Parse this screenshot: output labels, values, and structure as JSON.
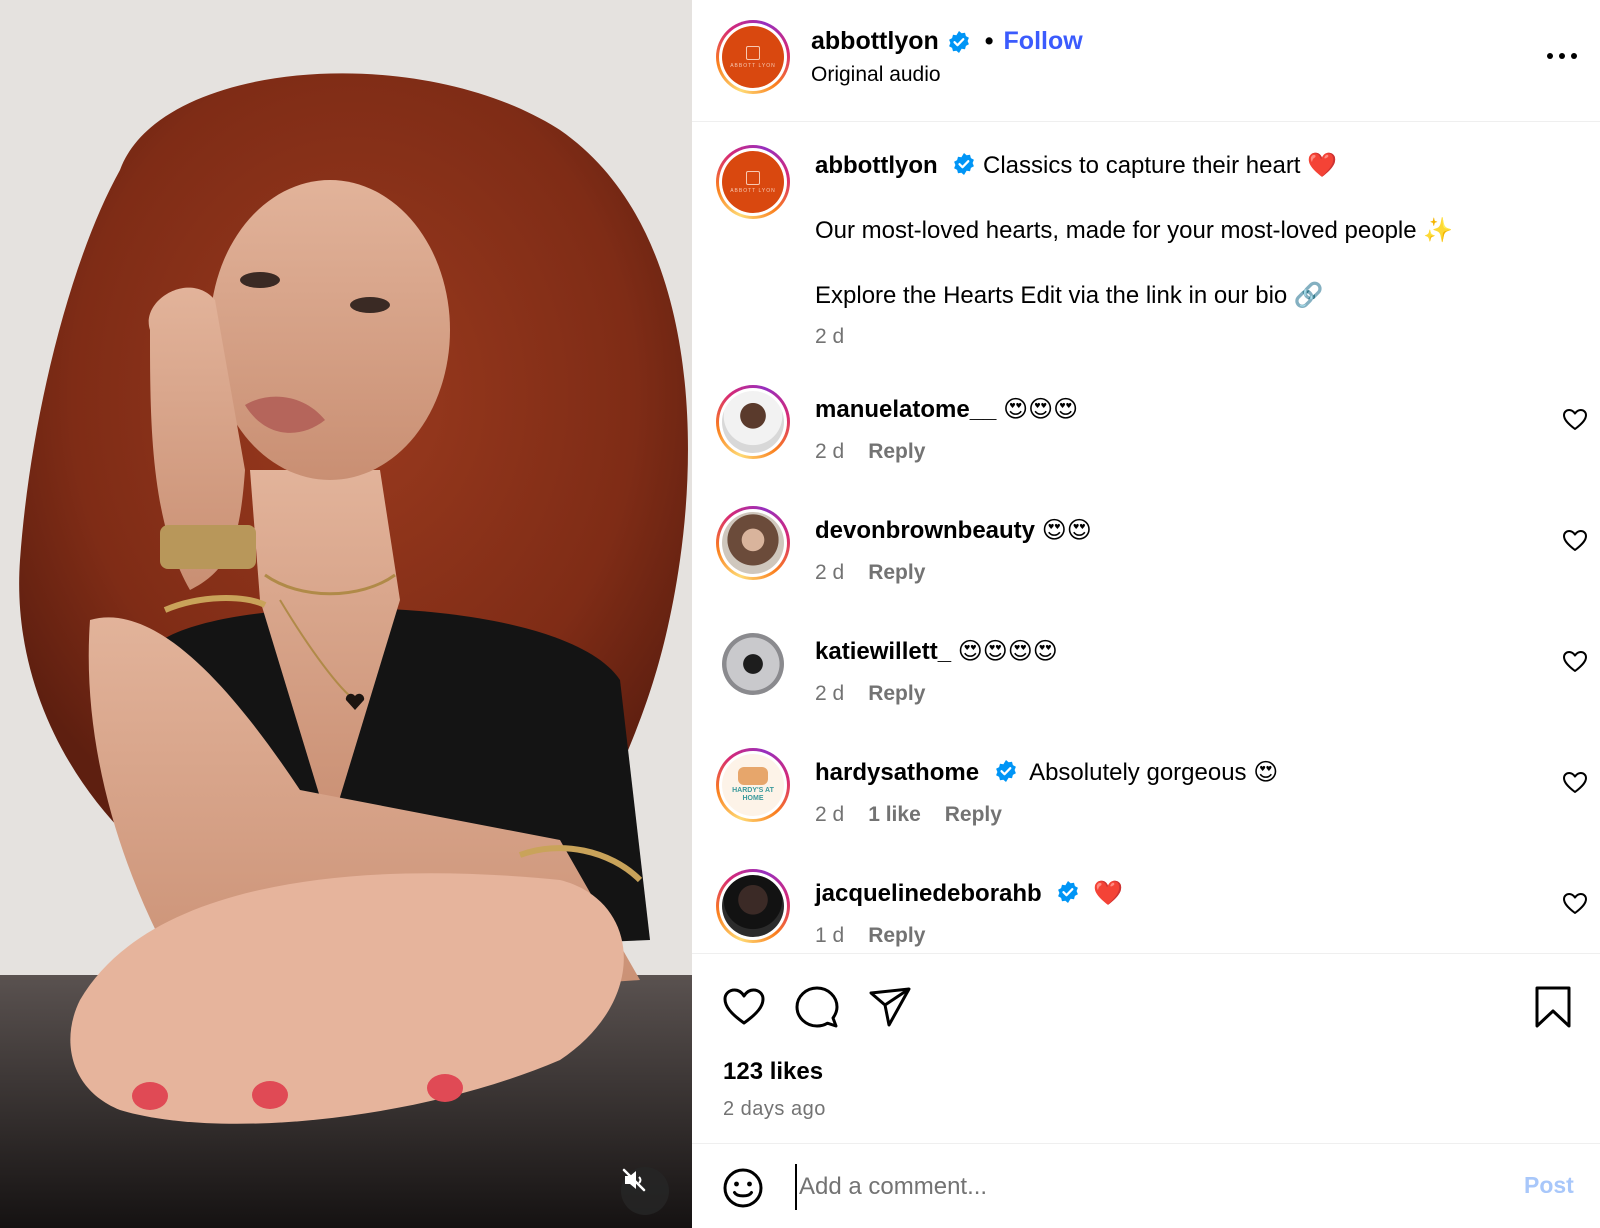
{
  "post": {
    "username": "abbottlyon",
    "follow_label": "Follow",
    "separator": "•",
    "audio": "Original audio",
    "brand_wordmark": "ABBOTT LYON"
  },
  "caption": {
    "username": "abbottlyon",
    "line1": "Classics to capture their heart ❤️",
    "line2": "Our most-loved hearts, made for your most-loved people ✨",
    "line3": "Explore the Hearts Edit via the link in our bio 🔗",
    "time": "2 d"
  },
  "comments": [
    {
      "username": "manuelatome__",
      "text": "😍😍😍",
      "time": "2 d",
      "likes": "",
      "reply": "Reply",
      "verified": false
    },
    {
      "username": "devonbrownbeauty",
      "text": "😍😍",
      "time": "2 d",
      "likes": "",
      "reply": "Reply",
      "verified": false
    },
    {
      "username": "katiewillett_",
      "text": "😍😍😍😍",
      "time": "2 d",
      "likes": "",
      "reply": "Reply",
      "verified": false
    },
    {
      "username": "hardysathome",
      "text": "Absolutely gorgeous 😍",
      "time": "2 d",
      "likes": "1 like",
      "reply": "Reply",
      "verified": true
    },
    {
      "username": "jacquelinedeborahb",
      "text": "❤️",
      "time": "1 d",
      "likes": "",
      "reply": "Reply",
      "verified": true
    }
  ],
  "hardys_avatar_text": "HARDY'S AT HOME",
  "stats": {
    "likes": "123 likes",
    "posted": "2 days ago"
  },
  "composer": {
    "placeholder": "Add a comment...",
    "post_label": "Post"
  },
  "colors": {
    "follow": "#3b5bfd",
    "verified": "#0095f6",
    "brand": "#d9480f",
    "muted": "#737373",
    "post_disabled": "#a8c7fa"
  },
  "icons": [
    "verified-badge-icon",
    "more-options-icon",
    "heart-icon",
    "comment-icon",
    "share-icon",
    "bookmark-icon",
    "emoji-icon",
    "mute-icon"
  ]
}
